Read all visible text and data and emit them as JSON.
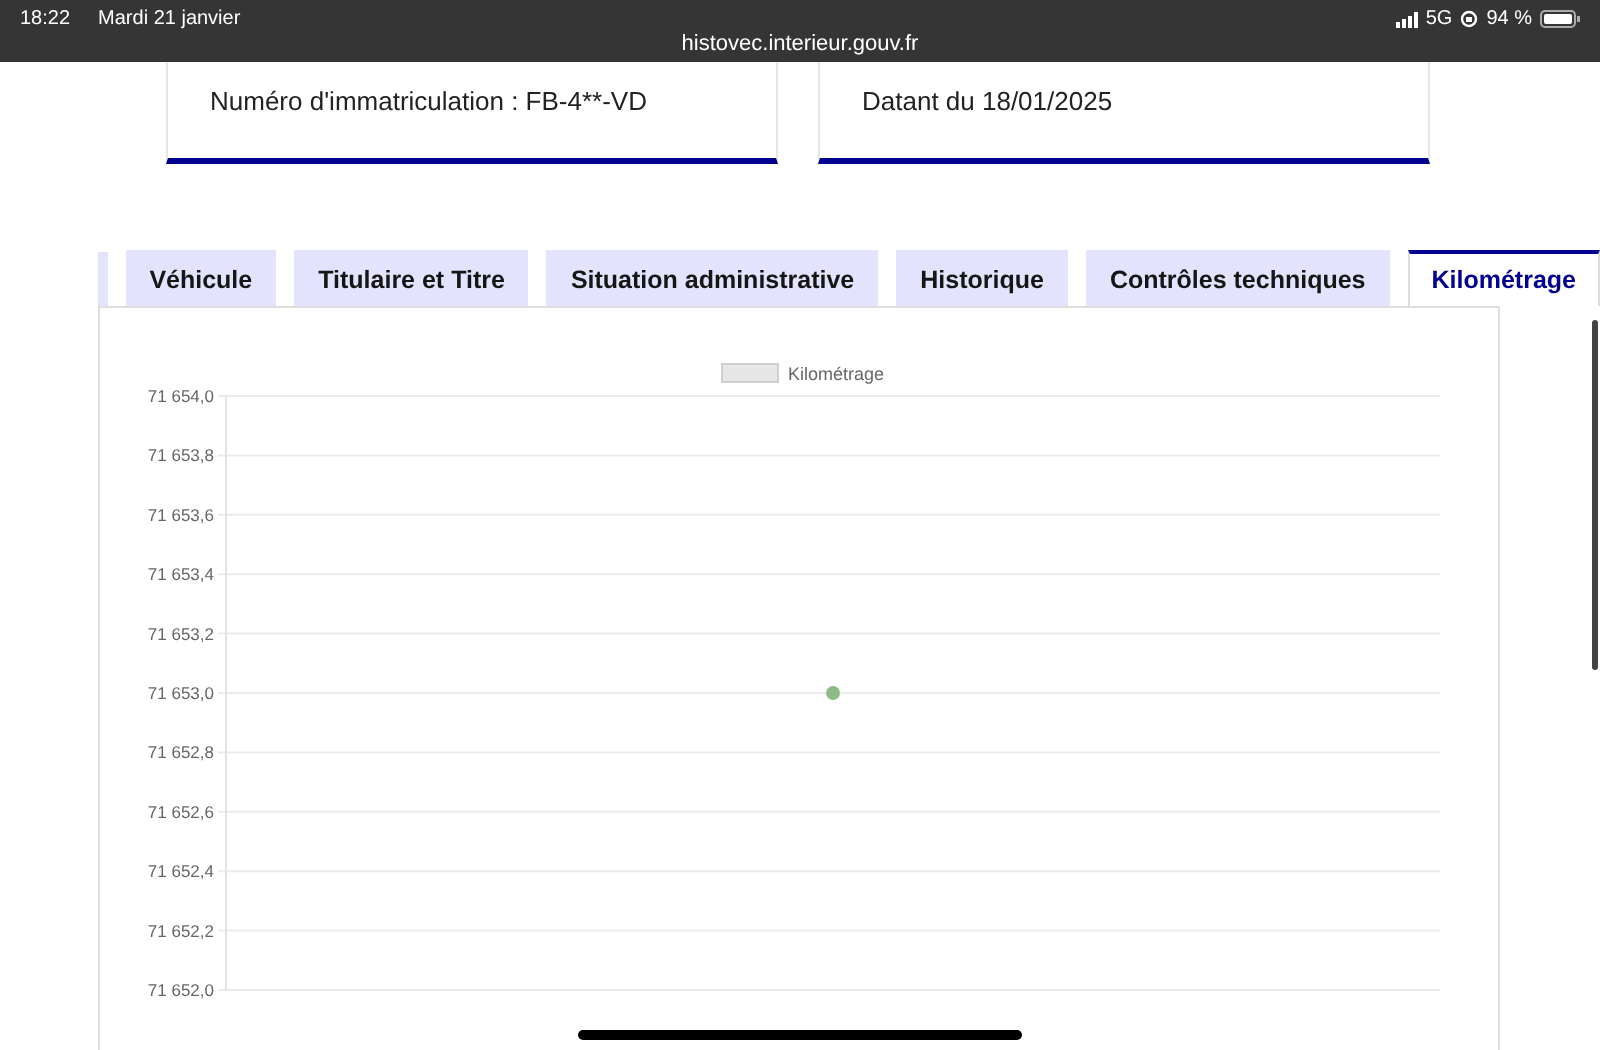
{
  "status_bar": {
    "time": "18:22",
    "date": "Mardi 21 janvier",
    "url": "histovec.interieur.gouv.fr",
    "network": "5G",
    "battery": "94 %"
  },
  "cards": [
    {
      "text": "Numéro d'immatriculation : FB-4**-VD"
    },
    {
      "text": "Datant du 18/01/2025"
    }
  ],
  "tabs": [
    {
      "label": "Véhicule",
      "selected": false
    },
    {
      "label": "Titulaire et Titre",
      "selected": false
    },
    {
      "label": "Situation administrative",
      "selected": false
    },
    {
      "label": "Historique",
      "selected": false
    },
    {
      "label": "Contrôles techniques",
      "selected": false
    },
    {
      "label": "Kilométrage",
      "selected": true
    }
  ],
  "chart": {
    "chart_data": {
      "type": "scatter",
      "grid": true,
      "series": [
        {
          "name": "Kilométrage",
          "color": "#8dbb86",
          "values": [
            71653.0
          ]
        }
      ],
      "ylim": [
        71652,
        71654
      ],
      "yticks": [
        {
          "value": 71654,
          "label": "71 654,0"
        },
        {
          "value": 71653.8,
          "label": "71 653,8"
        },
        {
          "value": 71653.6,
          "label": "71 653,6"
        },
        {
          "value": 71653.4,
          "label": "71 653,4"
        },
        {
          "value": 71653.2,
          "label": "71 653,2"
        },
        {
          "value": 71653,
          "label": "71 653,0"
        },
        {
          "value": 71652.8,
          "label": "71 652,8"
        },
        {
          "value": 71652.6,
          "label": "71 652,6"
        },
        {
          "value": 71652.4,
          "label": "71 652,4"
        },
        {
          "value": 71652.2,
          "label": "71 652,2"
        },
        {
          "value": 71652,
          "label": "71 652,0"
        }
      ]
    }
  }
}
